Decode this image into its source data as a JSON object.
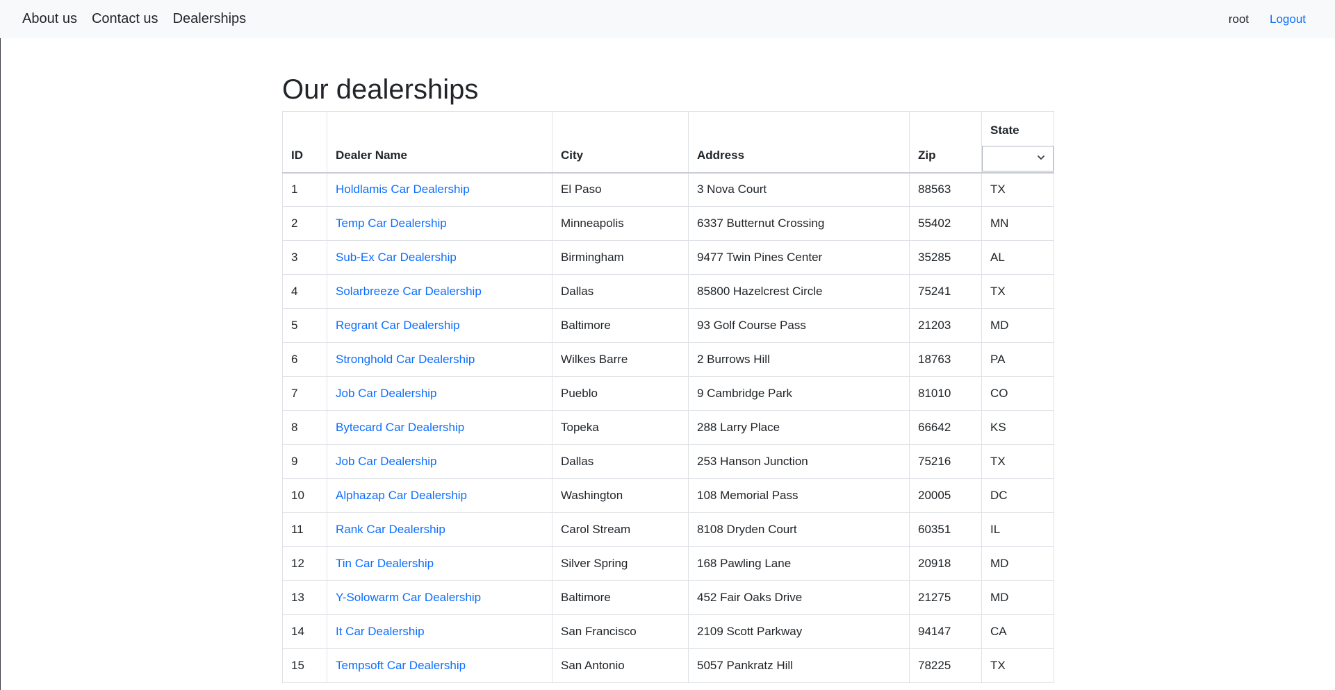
{
  "nav": {
    "links": [
      "About us",
      "Contact us",
      "Dealerships"
    ],
    "user": "root",
    "logout": "Logout"
  },
  "page": {
    "title": "Our dealerships"
  },
  "table": {
    "headers": {
      "id": "ID",
      "name": "Dealer Name",
      "city": "City",
      "address": "Address",
      "zip": "Zip",
      "state": "State"
    },
    "state_filter_value": "",
    "rows": [
      {
        "id": "1",
        "name": "Holdlamis Car Dealership",
        "city": "El Paso",
        "address": "3 Nova Court",
        "zip": "88563",
        "state": "TX"
      },
      {
        "id": "2",
        "name": "Temp Car Dealership",
        "city": "Minneapolis",
        "address": "6337 Butternut Crossing",
        "zip": "55402",
        "state": "MN"
      },
      {
        "id": "3",
        "name": "Sub-Ex Car Dealership",
        "city": "Birmingham",
        "address": "9477 Twin Pines Center",
        "zip": "35285",
        "state": "AL"
      },
      {
        "id": "4",
        "name": "Solarbreeze Car Dealership",
        "city": "Dallas",
        "address": "85800 Hazelcrest Circle",
        "zip": "75241",
        "state": "TX"
      },
      {
        "id": "5",
        "name": "Regrant Car Dealership",
        "city": "Baltimore",
        "address": "93 Golf Course Pass",
        "zip": "21203",
        "state": "MD"
      },
      {
        "id": "6",
        "name": "Stronghold Car Dealership",
        "city": "Wilkes Barre",
        "address": "2 Burrows Hill",
        "zip": "18763",
        "state": "PA"
      },
      {
        "id": "7",
        "name": "Job Car Dealership",
        "city": "Pueblo",
        "address": "9 Cambridge Park",
        "zip": "81010",
        "state": "CO"
      },
      {
        "id": "8",
        "name": "Bytecard Car Dealership",
        "city": "Topeka",
        "address": "288 Larry Place",
        "zip": "66642",
        "state": "KS"
      },
      {
        "id": "9",
        "name": "Job Car Dealership",
        "city": "Dallas",
        "address": "253 Hanson Junction",
        "zip": "75216",
        "state": "TX"
      },
      {
        "id": "10",
        "name": "Alphazap Car Dealership",
        "city": "Washington",
        "address": "108 Memorial Pass",
        "zip": "20005",
        "state": "DC"
      },
      {
        "id": "11",
        "name": "Rank Car Dealership",
        "city": "Carol Stream",
        "address": "8108 Dryden Court",
        "zip": "60351",
        "state": "IL"
      },
      {
        "id": "12",
        "name": "Tin Car Dealership",
        "city": "Silver Spring",
        "address": "168 Pawling Lane",
        "zip": "20918",
        "state": "MD"
      },
      {
        "id": "13",
        "name": "Y-Solowarm Car Dealership",
        "city": "Baltimore",
        "address": "452 Fair Oaks Drive",
        "zip": "21275",
        "state": "MD"
      },
      {
        "id": "14",
        "name": "It Car Dealership",
        "city": "San Francisco",
        "address": "2109 Scott Parkway",
        "zip": "94147",
        "state": "CA"
      },
      {
        "id": "15",
        "name": "Tempsoft Car Dealership",
        "city": "San Antonio",
        "address": "5057 Pankratz Hill",
        "zip": "78225",
        "state": "TX"
      }
    ]
  }
}
